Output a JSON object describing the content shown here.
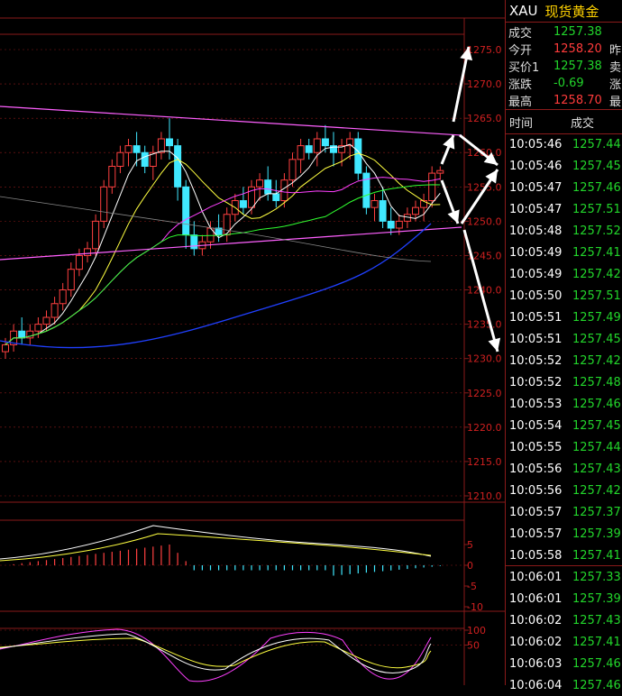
{
  "header": {
    "symbol": "XAU",
    "name": "现货黄金"
  },
  "quote": [
    {
      "label": "成交",
      "value": "1257.38",
      "color": "green",
      "extra": ""
    },
    {
      "label": "今开",
      "value": "1258.20",
      "color": "red",
      "extra": "昨"
    },
    {
      "label": "买价1",
      "value": "1257.38",
      "color": "green",
      "extra": "卖"
    },
    {
      "label": "涨跌",
      "value": "-0.69",
      "color": "green",
      "extra": "涨"
    },
    {
      "label": "最高",
      "value": "1258.70",
      "color": "red",
      "extra": "最"
    }
  ],
  "ticks_header": {
    "time": "时间",
    "price": "成交"
  },
  "ticks": [
    {
      "time": "10:05:46",
      "price": "1257.44"
    },
    {
      "time": "10:05:46",
      "price": "1257.45"
    },
    {
      "time": "10:05:47",
      "price": "1257.46"
    },
    {
      "time": "10:05:47",
      "price": "1257.51"
    },
    {
      "time": "10:05:48",
      "price": "1257.52"
    },
    {
      "time": "10:05:49",
      "price": "1257.41"
    },
    {
      "time": "10:05:49",
      "price": "1257.42"
    },
    {
      "time": "10:05:50",
      "price": "1257.51"
    },
    {
      "time": "10:05:51",
      "price": "1257.49"
    },
    {
      "time": "10:05:51",
      "price": "1257.45"
    },
    {
      "time": "10:05:52",
      "price": "1257.42"
    },
    {
      "time": "10:05:52",
      "price": "1257.48"
    },
    {
      "time": "10:05:53",
      "price": "1257.46"
    },
    {
      "time": "10:05:54",
      "price": "1257.45"
    },
    {
      "time": "10:05:55",
      "price": "1257.44"
    },
    {
      "time": "10:05:56",
      "price": "1257.43"
    },
    {
      "time": "10:05:56",
      "price": "1257.42"
    },
    {
      "time": "10:05:57",
      "price": "1257.37"
    },
    {
      "time": "10:05:57",
      "price": "1257.39"
    },
    {
      "time": "10:05:58",
      "price": "1257.41"
    },
    {
      "time": "10:06:01",
      "price": "1257.33"
    },
    {
      "time": "10:06:01",
      "price": "1257.39"
    },
    {
      "time": "10:06:02",
      "price": "1257.43"
    },
    {
      "time": "10:06:02",
      "price": "1257.41"
    },
    {
      "time": "10:06:03",
      "price": "1257.46"
    },
    {
      "time": "10:06:04",
      "price": "1257.46"
    }
  ],
  "price_axis": {
    "ticks": [
      "1275.0",
      "1270.0",
      "1265.0",
      "1260.0",
      "1255.0",
      "1250.0",
      "1245.0",
      "1240.0",
      "1235.0",
      "1230.0",
      "1225.0",
      "1220.0",
      "1215.0",
      "1210.0"
    ]
  },
  "macd_axis": {
    "ticks": [
      "5",
      "0",
      "-5",
      "-10"
    ]
  },
  "kdj_axis": {
    "ticks": [
      "100",
      "50"
    ]
  },
  "colors": {
    "up": "#ff4040",
    "down": "#40e8ff",
    "grid": "#8a1a1a",
    "axis_text": "#d02020"
  },
  "chart_data": {
    "type": "candlestick",
    "title": "",
    "ylim": [
      1210,
      1275
    ],
    "candles": [
      [
        1231,
        1233,
        1230,
        1232
      ],
      [
        1232,
        1235,
        1231,
        1234
      ],
      [
        1234,
        1236,
        1232,
        1233
      ],
      [
        1233,
        1235,
        1232,
        1234
      ],
      [
        1234,
        1236,
        1233,
        1235
      ],
      [
        1235,
        1237,
        1234,
        1236
      ],
      [
        1236,
        1239,
        1235,
        1238
      ],
      [
        1238,
        1241,
        1237,
        1240
      ],
      [
        1240,
        1244,
        1239,
        1243
      ],
      [
        1243,
        1246,
        1242,
        1245
      ],
      [
        1245,
        1247,
        1244,
        1246
      ],
      [
        1246,
        1251,
        1245,
        1250
      ],
      [
        1250,
        1256,
        1249,
        1255
      ],
      [
        1255,
        1259,
        1254,
        1258
      ],
      [
        1258,
        1261,
        1257,
        1260
      ],
      [
        1260,
        1262,
        1258,
        1261
      ],
      [
        1261,
        1263,
        1258,
        1260
      ],
      [
        1260,
        1261,
        1257,
        1258
      ],
      [
        1258,
        1261,
        1256,
        1260
      ],
      [
        1260,
        1263,
        1259,
        1262
      ],
      [
        1262,
        1265,
        1259,
        1261
      ],
      [
        1261,
        1262,
        1253,
        1255
      ],
      [
        1255,
        1256,
        1246,
        1248
      ],
      [
        1248,
        1250,
        1245,
        1246
      ],
      [
        1246,
        1248,
        1245,
        1247
      ],
      [
        1247,
        1250,
        1246,
        1249
      ],
      [
        1249,
        1251,
        1247,
        1248
      ],
      [
        1248,
        1252,
        1247,
        1251
      ],
      [
        1251,
        1254,
        1250,
        1253
      ],
      [
        1253,
        1255,
        1251,
        1252
      ],
      [
        1252,
        1256,
        1251,
        1255
      ],
      [
        1255,
        1257,
        1253,
        1256
      ],
      [
        1256,
        1258,
        1253,
        1254
      ],
      [
        1254,
        1256,
        1252,
        1253
      ],
      [
        1253,
        1257,
        1252,
        1256
      ],
      [
        1256,
        1260,
        1255,
        1259
      ],
      [
        1259,
        1262,
        1257,
        1261
      ],
      [
        1261,
        1262,
        1259,
        1260
      ],
      [
        1260,
        1263,
        1258,
        1262
      ],
      [
        1262,
        1264,
        1260,
        1261
      ],
      [
        1261,
        1263,
        1258,
        1260
      ],
      [
        1260,
        1262,
        1258,
        1261
      ],
      [
        1261,
        1263,
        1259,
        1262
      ],
      [
        1262,
        1263,
        1256,
        1257
      ],
      [
        1257,
        1258,
        1251,
        1252
      ],
      [
        1252,
        1254,
        1250,
        1253
      ],
      [
        1253,
        1255,
        1249,
        1250
      ],
      [
        1250,
        1252,
        1248,
        1249
      ],
      [
        1249,
        1251,
        1248,
        1250
      ],
      [
        1250,
        1252,
        1249,
        1251
      ],
      [
        1251,
        1253,
        1250,
        1252
      ],
      [
        1252,
        1254,
        1250,
        1253
      ],
      [
        1253,
        1258,
        1252,
        1257
      ],
      [
        1257,
        1258,
        1256,
        1257.38
      ]
    ]
  }
}
